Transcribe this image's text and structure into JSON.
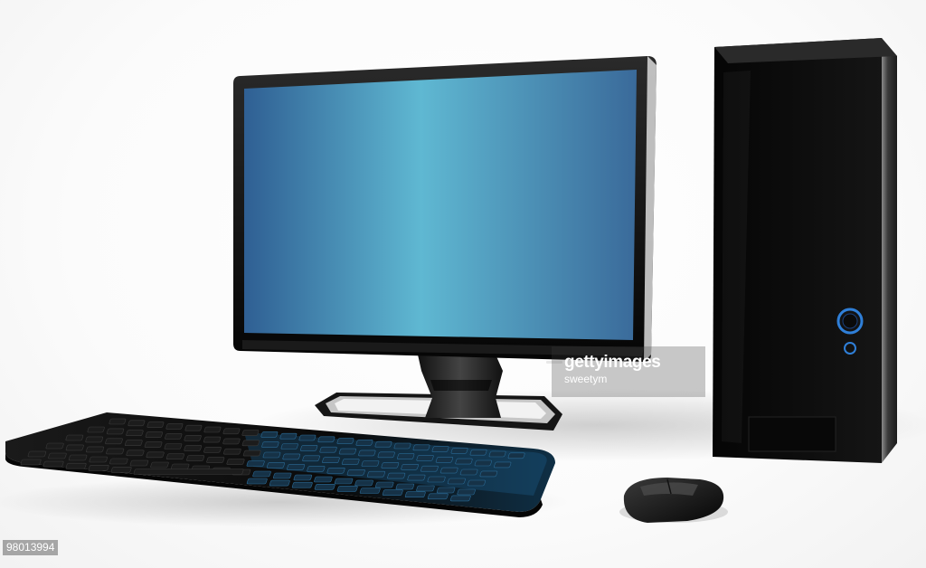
{
  "watermark": {
    "logo_text": "gettyimages",
    "credit": "sweetym"
  },
  "image_id": "98013994",
  "icons": {
    "power_button": "power-ring-icon",
    "secondary_button": "small-ring-icon"
  },
  "colors": {
    "screen_edge": "#3a6f9e",
    "screen_center": "#5fb3cf",
    "device_body": "#0b0b0b",
    "power_glow": "#2f7fd8",
    "keyboard_glow": "#1f6fa6",
    "background": "#ffffff"
  }
}
